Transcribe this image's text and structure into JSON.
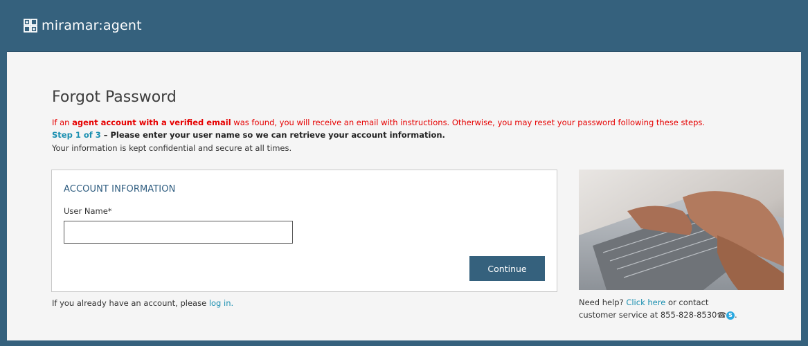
{
  "header": {
    "brand_name": "miramar:agent",
    "logo_icon": "grid-logo-icon"
  },
  "page": {
    "title": "Forgot Password",
    "notice_prefix": "If an ",
    "notice_bold": "agent account with a verified email",
    "notice_suffix": " was found, you will receive an email with instructions. Otherwise, you may reset your password following these steps.",
    "step_label": "Step 1 of 3",
    "step_text": " – Please enter your user name so we can retrieve your account information.",
    "info_text": "Your information is kept confidential and secure at all times."
  },
  "form": {
    "section_title": "ACCOUNT INFORMATION",
    "username_label": "User Name",
    "required_mark": "*",
    "username_value": "",
    "continue_label": "Continue"
  },
  "footer": {
    "login_prefix": "If you already have an account, please ",
    "login_link": "log in.",
    "help_prefix": "Need help? ",
    "help_link": "Click here",
    "help_suffix": " or contact",
    "contact_text": "customer service at 855-828-8530",
    "contact_end": "."
  },
  "colors": {
    "header_bg": "#35617d",
    "notice_red": "#e60000",
    "link_blue": "#1a8fb0",
    "button_bg": "#35617d"
  }
}
